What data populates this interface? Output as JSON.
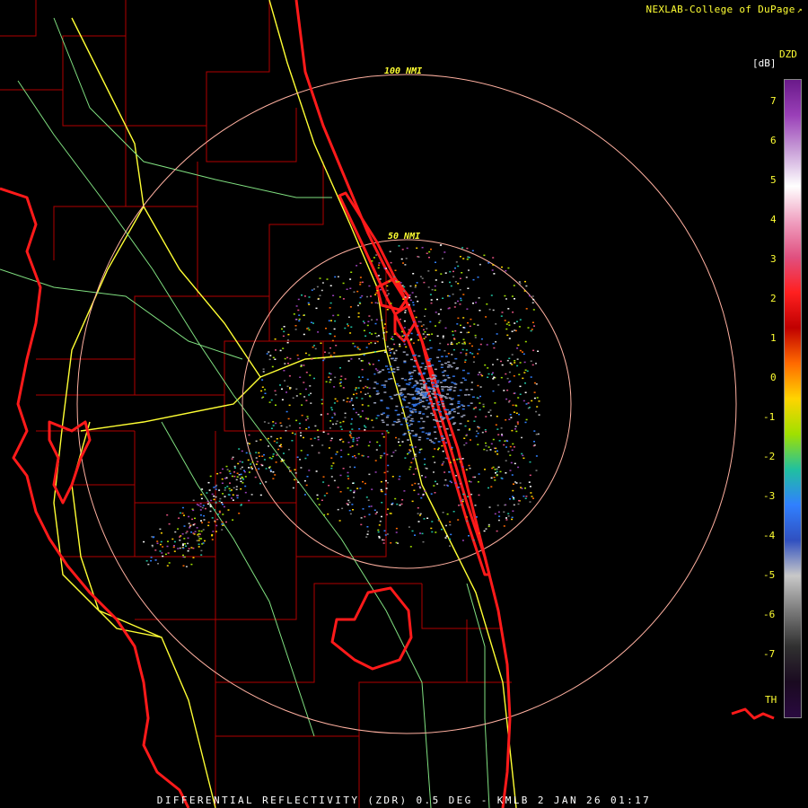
{
  "credit": {
    "text": "NEXLAB-College of DuPage",
    "ext_icon": "external-link-icon"
  },
  "footer": {
    "text": "DIFFERENTIAL REFLECTIVITY (ZDR) 0.5 DEG - KMLB 2 JAN 26 01:17"
  },
  "legend": {
    "product": "DZD",
    "unit": "[dB]",
    "ticks": [
      "7",
      "6",
      "5",
      "4",
      "3",
      "2",
      "1",
      "0",
      "-1",
      "-2",
      "-3",
      "-4",
      "-5",
      "-6",
      "-7"
    ],
    "th_label": "TH",
    "colors": [
      "#6a1a8a",
      "#9a40b8",
      "#c9a0d8",
      "#ffffff",
      "#f0a0c0",
      "#e05080",
      "#ff2020",
      "#c00000",
      "#ff6a00",
      "#ffd400",
      "#a0e000",
      "#20c0a0",
      "#3080ff",
      "#3050c0",
      "#c8c8c8",
      "#7a7a7a",
      "#303030",
      "#1a0a20",
      "#2a0a40"
    ]
  },
  "range_rings": [
    {
      "label": "100 NMI"
    },
    {
      "label": "50 NMI"
    }
  ],
  "colors": {
    "coast": "#ff1a1a",
    "county": "#b00000",
    "highway_major": "#ffff33",
    "highway_minor": "#80e080",
    "ring": "#ffb0a0"
  }
}
